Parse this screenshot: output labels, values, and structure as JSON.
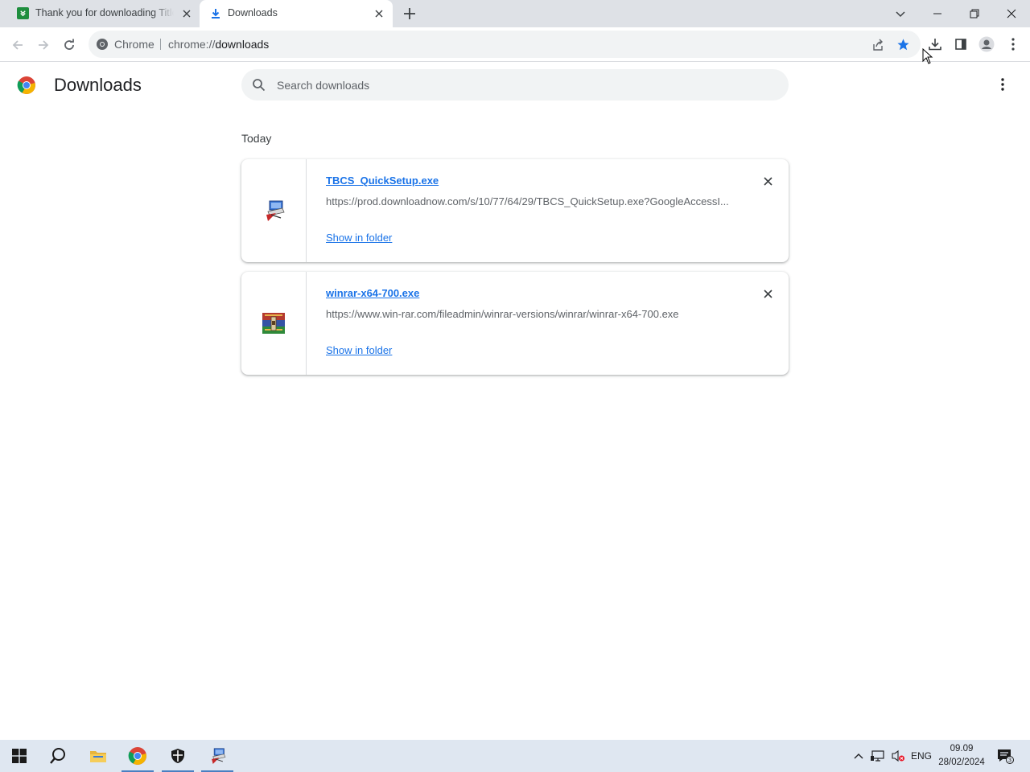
{
  "tabs": [
    {
      "title": "Thank you for downloading Title",
      "icon": "download-site-icon",
      "active": false
    },
    {
      "title": "Downloads",
      "icon": "download-icon",
      "active": true
    }
  ],
  "omnibox": {
    "site_label": "Chrome",
    "url_prefix": "chrome://",
    "url_host": "downloads"
  },
  "page": {
    "title": "Downloads",
    "search_placeholder": "Search downloads",
    "section_label": "Today"
  },
  "downloads": [
    {
      "filename": "TBCS_QuickSetup.exe",
      "url": "https://prod.downloadnow.com/s/10/77/64/29/TBCS_QuickSetup.exe?GoogleAccessI...",
      "action": "Show in folder",
      "icon": "installer-icon"
    },
    {
      "filename": "winrar-x64-700.exe",
      "url": "https://www.win-rar.com/fileadmin/winrar-versions/winrar/winrar-x64-700.exe",
      "action": "Show in folder",
      "icon": "winrar-icon"
    }
  ],
  "taskbar": {
    "language": "ENG",
    "time": "09.09",
    "date": "28/02/2024",
    "notification_count": "3"
  },
  "colors": {
    "accent": "#1a73e8",
    "tabstrip": "#dee1e6",
    "taskbar": "#dfe7f1"
  }
}
